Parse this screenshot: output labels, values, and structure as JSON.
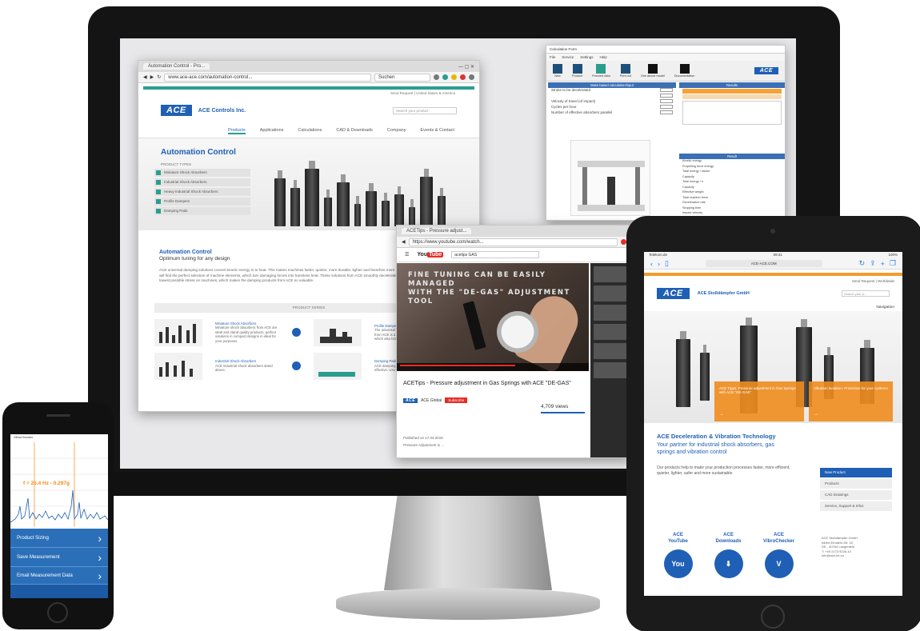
{
  "browser_main": {
    "tab_title": "Automation Control - Pro...",
    "url": "www.ace-ace.com/automation-control...",
    "search_placeholder": "Suchen",
    "top_links": "Send Request | United States & America",
    "company": "ACE Controls Inc.",
    "logo": "ACE",
    "search_box": "Search your product",
    "nav": [
      "Products",
      "Applications",
      "Calculations",
      "CAD & Downloads",
      "Company",
      "Events & Contact"
    ],
    "hero_title": "Automation Control",
    "product_types_label": "PRODUCT TYPES",
    "product_types": [
      "Miniature Shock Absorbers",
      "Industrial Shock Absorbers",
      "Heavy Industrial Shock Absorbers",
      "Profile Dampers",
      "Damping Pads"
    ],
    "info_title": "Automation Control",
    "info_subtitle": "Optimum tuning for any design",
    "info_text": "ACE universal damping solutions convert kinetic energy in to heat. This makes machines faster, quieter, more durable, lighter and therefore more competitive and profitable. Here you will find the perfect selection of machine elements, which turn damaging forces into harmless heat. These solutions from ACE smoothly decelerate moving loads. This involves the lowest possible stress on machines, which makes the damping products from ACE so valuable.",
    "series_bar": "PRODUCT SERIES",
    "series": [
      {
        "name": "Miniature Shock Absorbers",
        "desc": "Miniature shock absorbers from ACE are ideal and stand quality products, perfect solutions in compact designs in ideal for your purposes."
      },
      {
        "name": "Profile Dampers",
        "desc": "The universal line of damping elements from ACE is a real and decisive factor, which also bring longevity and growth."
      },
      {
        "name": "Industrial Shock Absorbers",
        "desc": "ACE industrial shock absorbers stand above."
      },
      {
        "name": "Damping Pads",
        "desc": "ACE damping pads are compact, effective. Use them for best."
      }
    ]
  },
  "calc_window": {
    "title": "Calculation Form",
    "menu": [
      "File",
      "Service",
      "Settings",
      "Help"
    ],
    "tools": [
      "New",
      "Product",
      "Proceed data",
      "Print out",
      "One above model",
      "Documentation"
    ],
    "logo": "ACE",
    "main_header": "Mass based calculation/input",
    "right_header": "Results",
    "form_rows": [
      "Stroke to be decelerated",
      "Velocity of travel (of impact)",
      "Cycles per hour",
      "Number of effective absorbers parallel"
    ],
    "results_header": "Result",
    "result_rows": [
      "Kinetic energy",
      "Propelling force energy",
      "Total energy / stroke",
      "Capacity",
      "Total energy / h",
      "Capacity",
      "Effective weight",
      "Total reaction force",
      "Deceleration rate",
      "Stopping time",
      "Impact velocity"
    ]
  },
  "youtube": {
    "tab_title": "ACETips - Pressure adjust...",
    "url": "https://www.youtube.com/watch...",
    "logo_you": "You",
    "logo_tube": "Tube",
    "search_value": "acetips GAS",
    "caption_line1": "FINE TUNING CAN BE EASILY MANAGED",
    "caption_line2": "WITH THE \"DE-GAS\" ADJUSTMENT TOOL",
    "video_title": "ACETips - Pressure adjustment in Gas Springs with ACE \"DE-GAS\"",
    "channel": "ACE Global",
    "subscribe": "Subscribe",
    "views": "4,709 views",
    "published": "Published on 17.04.2015",
    "description": "Pressure Adjustment is ..."
  },
  "ipad": {
    "carrier": "Telekom.de",
    "time": "09:41",
    "battery": "100%",
    "address": "ACE-ACE.COM",
    "top_links": "Send Request | Worldwide",
    "logo": "ACE",
    "company": "ACE Stoßdämpfer GmbH",
    "search": "Search your p...",
    "nav_label": "Navigation",
    "overlay1": "ACE Tipps: Pressure adjustment in Gas Springs with ACE \"DE-GAS\"",
    "overlay2": "Vibration Isolation: Protection for your systems",
    "overlay_arrow": "→",
    "h2": "ACE Deceleration & Vibration Technology",
    "h3": "Your partner for industrial shock absorbers, gas springs and vibration control",
    "body": "Our products help to make your production processes faster, more efficient, quieter, lighter, safer and more sustainable.",
    "right_menu": [
      "New Product",
      "Products",
      "CAD Drawings",
      "Service, Support & Infos"
    ],
    "icons": [
      {
        "label1": "ACE",
        "label2": "YouTube",
        "glyph": "You"
      },
      {
        "label1": "ACE",
        "label2": "Downloads",
        "glyph": "⬇"
      },
      {
        "label1": "ACE",
        "label2": "VibroChecker",
        "glyph": "V"
      }
    ],
    "address_box": "ACE Stoßdämpfer GmbH\nAlbert-Einstein-Str. 15\nDE - 40764 Langenfeld\nT: +49 2173 9226-10\ninfo@ace-int.eu"
  },
  "iphone": {
    "graph_title": "VibroChecker",
    "freq": "f = 25.4 Hz - 0.297g",
    "menu": [
      "Product Sizing",
      "Save Measurement",
      "Email Measurement Data"
    ]
  }
}
